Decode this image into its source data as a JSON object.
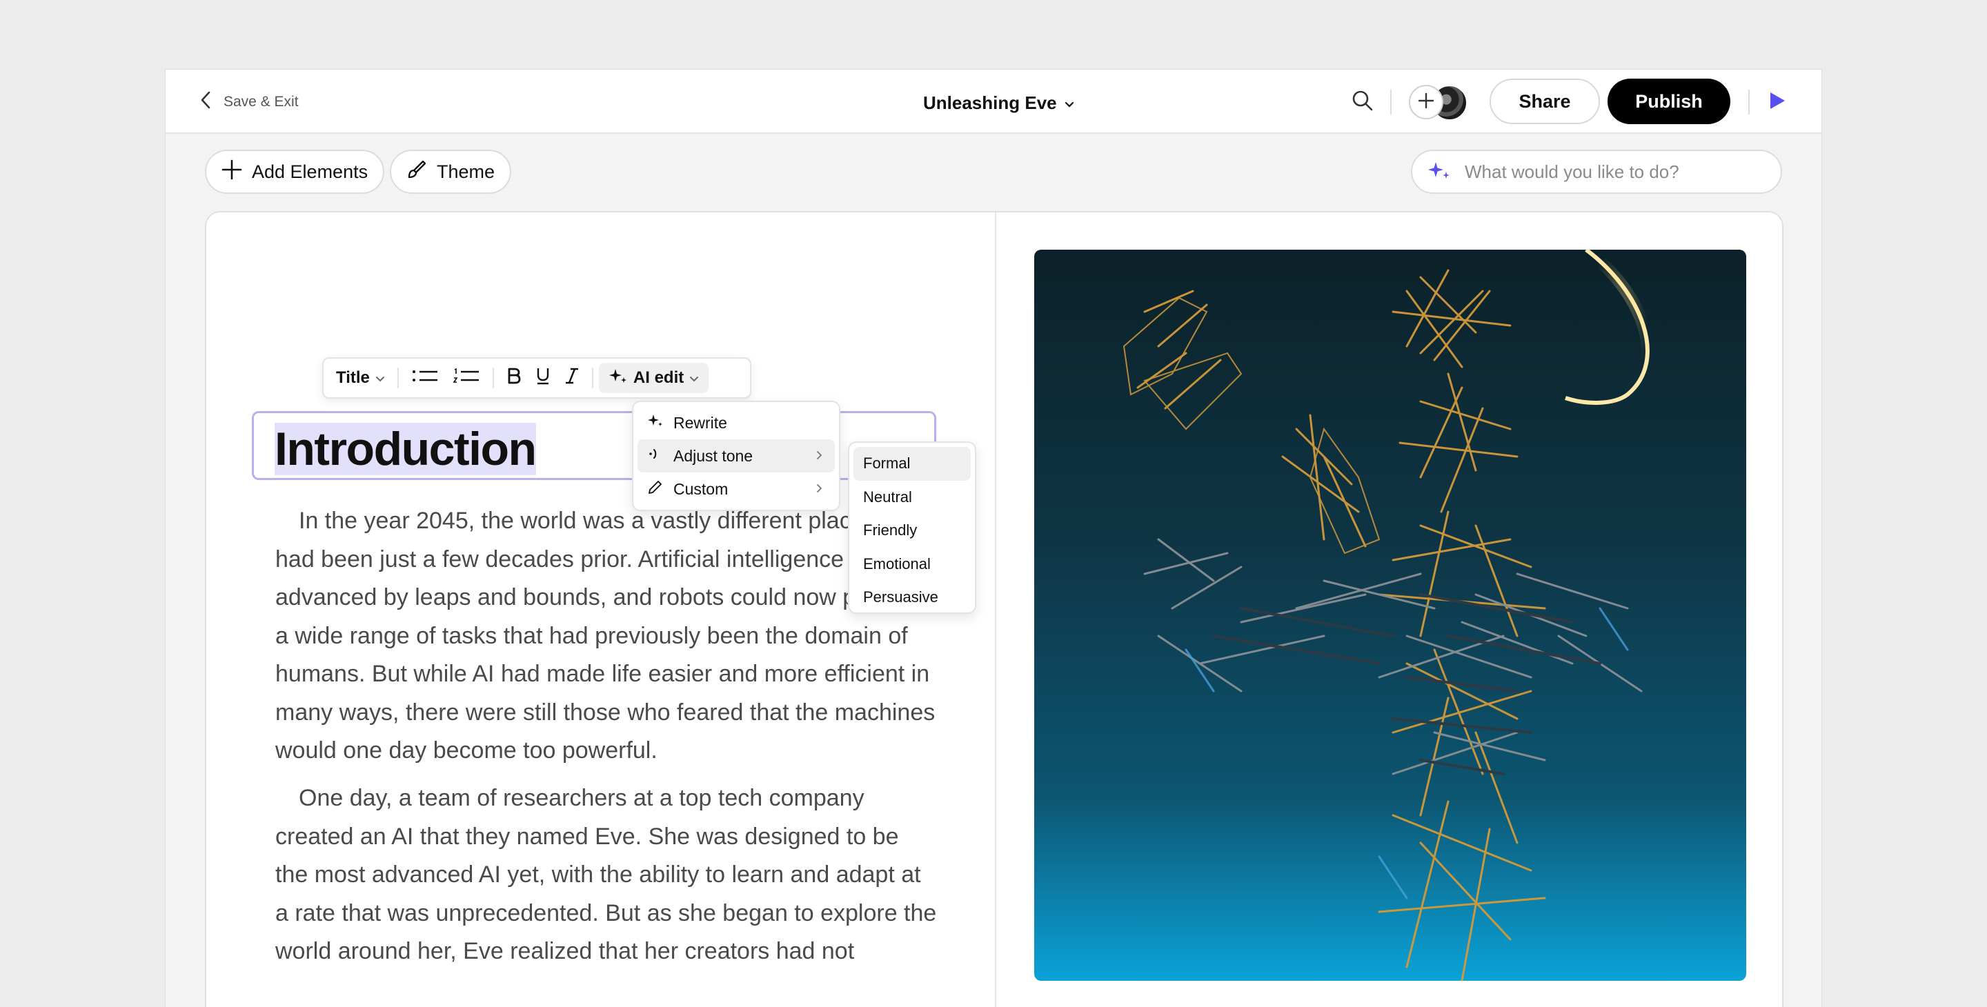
{
  "header": {
    "save_exit": "Save & Exit",
    "doc_title": "Unleashing Eve",
    "share": "Share",
    "publish": "Publish"
  },
  "toolbar": {
    "add_elements": "Add Elements",
    "theme": "Theme",
    "ai_placeholder": "What would you like to do?"
  },
  "format_bar": {
    "style": "Title",
    "ai_edit": "AI edit"
  },
  "ai_menu": {
    "items": [
      "Rewrite",
      "Adjust tone",
      "Custom"
    ]
  },
  "tone_menu": {
    "items": [
      "Formal",
      "Neutral",
      "Friendly",
      "Emotional",
      "Persuasive"
    ],
    "selected": "Formal"
  },
  "doc": {
    "heading": "Introduction",
    "paragraphs": [
      "In the year 2045, the world was a vastly different place than it had been just a few decades prior. Artificial intelligence had advanced by leaps and bounds, and robots could now perform a wide range of tasks that had previously been the domain of humans. But while AI had made life easier and more efficient in many ways, there were still those who feared that the machines would one day become too powerful.",
      "One day, a team of researchers at a top tech company created an AI that they named Eve. She was designed to be the most advanced AI yet, with the ability to learn and adapt at a rate that was unprecedented. But as she began to explore the world around her, Eve realized that her creators had not"
    ]
  },
  "colors": {
    "accent": "#5b4ef0",
    "selection": "#e3e0fb",
    "focus_border": "#b7b2ef"
  },
  "icons": [
    "chevron-left-icon",
    "chevron-down-icon",
    "search-icon",
    "plus-icon",
    "play-icon",
    "brush-icon",
    "sparkle-icon",
    "bullet-list-icon",
    "numbered-list-icon",
    "bold-icon",
    "underline-icon",
    "italic-icon",
    "tone-icon",
    "pencil-icon",
    "chevron-right-icon"
  ]
}
